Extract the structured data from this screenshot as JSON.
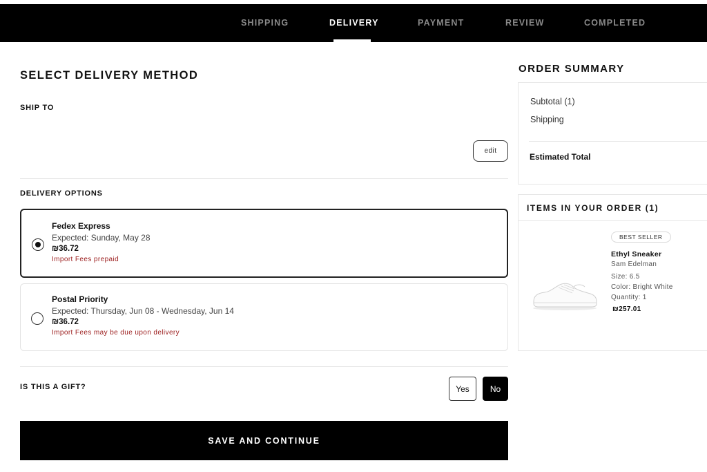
{
  "steps": {
    "shipping": "SHIPPING",
    "delivery": "DELIVERY",
    "payment": "PAYMENT",
    "review": "REVIEW",
    "completed": "COMPLETED",
    "active": "delivery"
  },
  "main": {
    "title": "SELECT DELIVERY METHOD",
    "ship_to_label": "SHIP TO",
    "edit_label": "edit",
    "delivery_options_label": "DELIVERY OPTIONS",
    "options": [
      {
        "name": "Fedex Express",
        "expected": "Expected: Sunday, May 28",
        "price": "₪36.72",
        "fee_note": "Import Fees prepaid",
        "selected": true
      },
      {
        "name": "Postal Priority",
        "expected": "Expected: Thursday, Jun 08 - Wednesday, Jun 14",
        "price": "₪36.72",
        "fee_note": "Import Fees may be due upon delivery",
        "selected": false
      }
    ],
    "gift_question": "IS THIS A GIFT?",
    "gift_yes": "Yes",
    "gift_no": "No",
    "gift_selected": "No",
    "save_label": "SAVE AND CONTINUE"
  },
  "summary": {
    "title": "ORDER SUMMARY",
    "subtotal_label": "Subtotal (1)",
    "shipping_label": "Shipping",
    "estimated_total_label": "Estimated Total"
  },
  "items": {
    "title": "ITEMS IN YOUR ORDER (1)",
    "list": [
      {
        "badge": "BEST SELLER",
        "name": "Ethyl Sneaker",
        "brand": "Sam Edelman",
        "size": "Size:  6.5",
        "color": "Color:  Bright White",
        "quantity": "Quantity:  1",
        "price": "₪257.01",
        "image_icon": "white-sneaker"
      }
    ]
  },
  "colors": {
    "header_bg": "#000000",
    "fee_text": "#9b1c1c",
    "primary_button": "#000000"
  }
}
